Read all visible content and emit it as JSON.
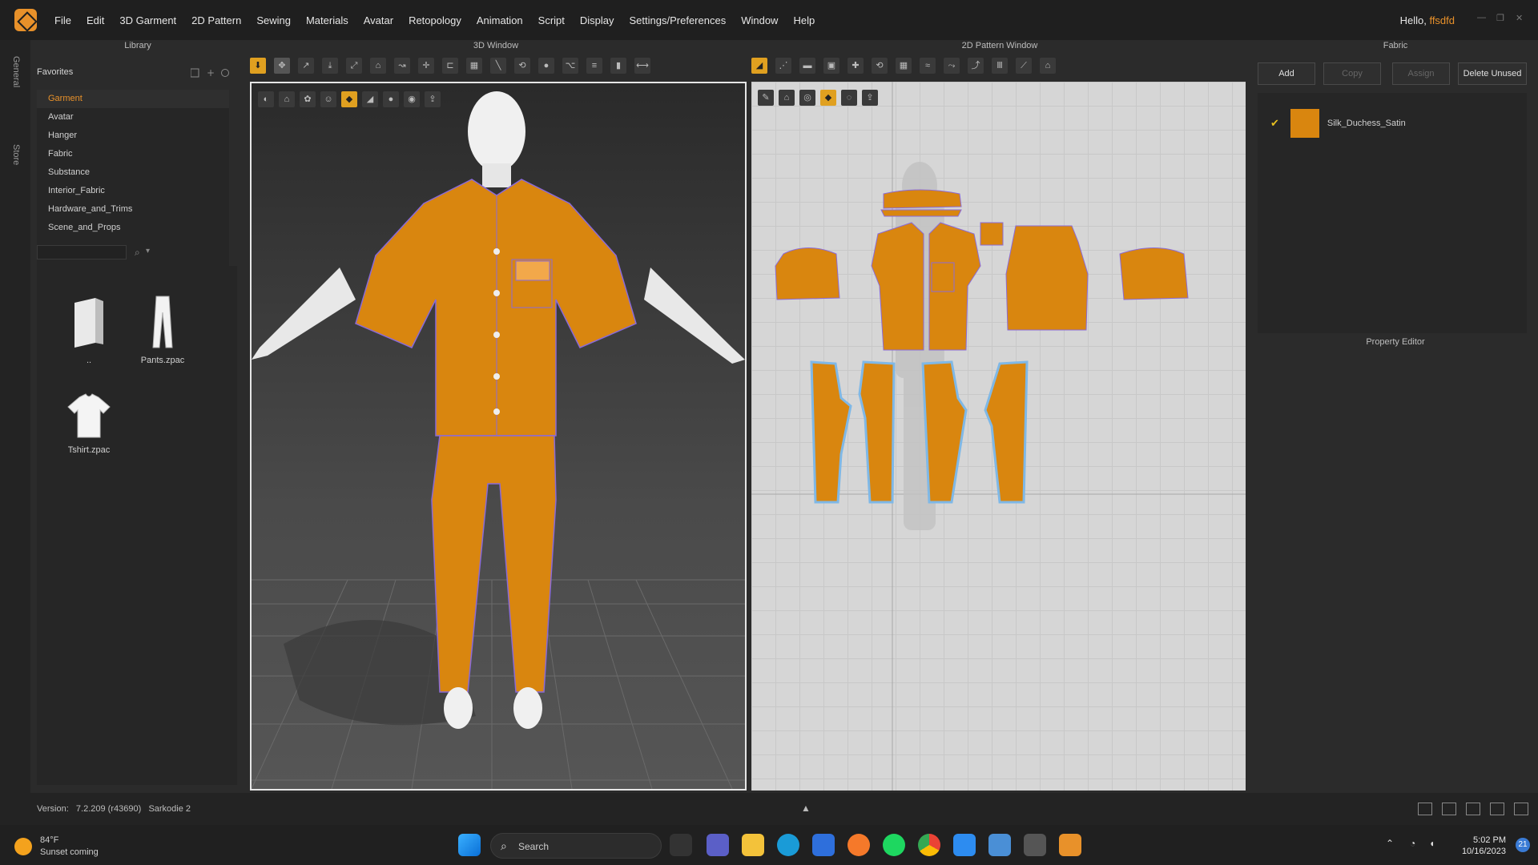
{
  "menubar": {
    "items": [
      "File",
      "Edit",
      "3D Garment",
      "2D Pattern",
      "Sewing",
      "Materials",
      "Avatar",
      "Retopology",
      "Animation",
      "Script",
      "Display",
      "Settings/Preferences",
      "Window",
      "Help"
    ],
    "hello_prefix": "Hello, ",
    "username": "ffsdfd"
  },
  "side_tabs": {
    "general": "General",
    "store": "Store"
  },
  "library": {
    "title": "Library",
    "favorites_label": "Favorites",
    "favorites": [
      "Garment",
      "Avatar",
      "Hanger",
      "Fabric",
      "Substance",
      "Interior_Fabric",
      "Hardware_and_Trims",
      "Scene_and_Props"
    ],
    "selected": "Garment",
    "files": [
      {
        "name": "..",
        "icon": "folder-up-icon"
      },
      {
        "name": "Pants.zpac",
        "icon": "pants-icon"
      },
      {
        "name": "Tshirt.zpac",
        "icon": "tshirt-icon"
      }
    ]
  },
  "window3d": {
    "title": "3D Window"
  },
  "window2d": {
    "title": "2D Pattern Window"
  },
  "fabric": {
    "title": "Fabric",
    "add": "Add",
    "copy": "Copy",
    "assign": "Assign",
    "delete_unused": "Delete Unused",
    "items": [
      {
        "name": "Silk_Duchess_Satin",
        "color": "#d9860f",
        "checked": true
      }
    ]
  },
  "property_editor": {
    "title": "Property Editor"
  },
  "status": {
    "version_label": "Version:",
    "version": "7.2.209 (r43690)",
    "project": "Sarkodie 2"
  },
  "taskbar": {
    "temperature": "84°F",
    "weather_text": "Sunset coming",
    "search_label": "Search",
    "time": "5:02 PM",
    "date": "10/16/2023",
    "notifications": "21"
  },
  "colors": {
    "accent": "#e8912a",
    "garment": "#d9860f",
    "pattern_outline": "#7fb8e6"
  }
}
